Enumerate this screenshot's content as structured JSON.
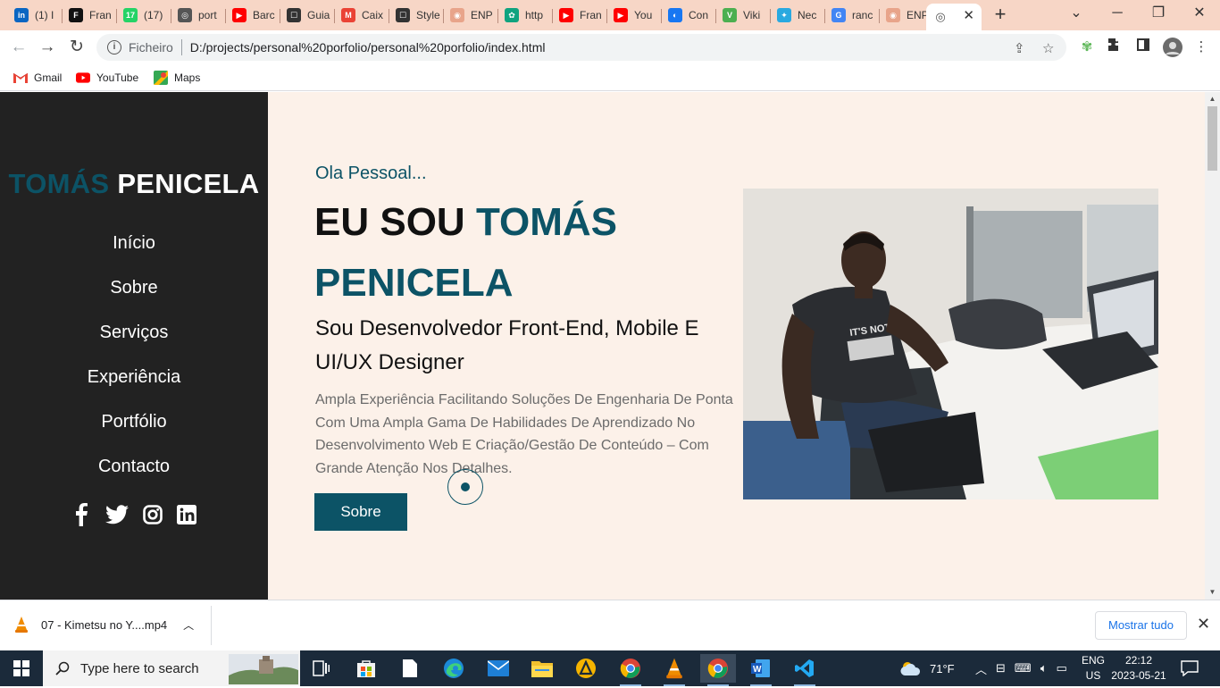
{
  "browser": {
    "tabs": [
      {
        "label": "(1) I",
        "icon": "linkedin-icon",
        "color": "#0a66c2",
        "glyph": "in"
      },
      {
        "label": "Fran",
        "icon": "framer-icon",
        "color": "#111111",
        "glyph": "F"
      },
      {
        "label": "(17)",
        "icon": "whatsapp-icon",
        "color": "#25d366",
        "glyph": "17"
      },
      {
        "label": "port",
        "icon": "globe-icon",
        "color": "#555555",
        "glyph": "◎"
      },
      {
        "label": "Barc",
        "icon": "youtube-icon",
        "color": "#ff0000",
        "glyph": "▶"
      },
      {
        "label": "Guia",
        "icon": "page-icon",
        "color": "#333333",
        "glyph": "☐"
      },
      {
        "label": "Caix",
        "icon": "gmail-icon",
        "color": "#ea4335",
        "glyph": "M"
      },
      {
        "label": "Style",
        "icon": "page-icon",
        "color": "#333333",
        "glyph": "☐"
      },
      {
        "label": "ENP",
        "icon": "enp-icon",
        "color": "#e8a48a",
        "glyph": "◉"
      },
      {
        "label": "http",
        "icon": "chatgpt-icon",
        "color": "#10a37f",
        "glyph": "✿"
      },
      {
        "label": "Fran",
        "icon": "youtube-icon",
        "color": "#ff0000",
        "glyph": "▶"
      },
      {
        "label": "You",
        "icon": "youtube-icon",
        "color": "#ff0000",
        "glyph": "▶"
      },
      {
        "label": "Con",
        "icon": "meta-icon",
        "color": "#1877f2",
        "glyph": "◐"
      },
      {
        "label": "Viki",
        "icon": "viki-icon",
        "color": "#4caf50",
        "glyph": "V"
      },
      {
        "label": "Nec",
        "icon": "nec-icon",
        "color": "#2aa9e0",
        "glyph": "✦"
      },
      {
        "label": "ranc",
        "icon": "google-icon",
        "color": "#4285f4",
        "glyph": "G"
      },
      {
        "label": "ENP",
        "icon": "enp-icon",
        "color": "#e8a48a",
        "glyph": "◉"
      }
    ],
    "active_tab_icon": "globe-icon",
    "address_scheme": "Ficheiro",
    "address_url": "D:/projects/personal%20porfolio/personal%20porfolio/index.html",
    "bookmarks": [
      {
        "label": "Gmail",
        "icon": "gmail-icon"
      },
      {
        "label": "YouTube",
        "icon": "youtube-icon"
      },
      {
        "label": "Maps",
        "icon": "maps-icon"
      }
    ]
  },
  "site": {
    "brand_first": "TOMÁS",
    "brand_last": "PENICELA",
    "nav": [
      "Início",
      "Sobre",
      "Serviços",
      "Experiência",
      "Portfólio",
      "Contacto"
    ],
    "socials": [
      "facebook-icon",
      "twitter-icon",
      "instagram-icon",
      "linkedin-icon"
    ],
    "hello": "Ola Pessoal...",
    "heading_prefix": "EU SOU",
    "heading_highlight_1": "TOMÁS",
    "heading_highlight_2": "PENICELA",
    "subtitle": "Sou Desenvolvedor Front-End, Mobile E UI/UX Designer",
    "description": "Ampla Experiência Facilitando Soluções De Engenharia De Ponta Com Uma Ampla Gama De Habilidades De Aprendizado No Desenvolvimento Web E Criação/Gestão De Conteúdo – Com Grande Atenção Nos Detalhes.",
    "cta_label": "Sobre",
    "photo_alt": "photo-of-tomas-penicela-at-desk",
    "colors": {
      "accent": "#0c5366",
      "sidebar": "#222222",
      "background": "#fcf1e9"
    }
  },
  "download": {
    "file_name": "07 - Kimetsu no Y....mp4",
    "show_all_label": "Mostrar tudo"
  },
  "taskbar": {
    "search_placeholder": "Type here to search",
    "weather": "71°F",
    "lang_top": "ENG",
    "lang_bottom": "US",
    "time": "22:12",
    "date": "2023-05-21"
  }
}
